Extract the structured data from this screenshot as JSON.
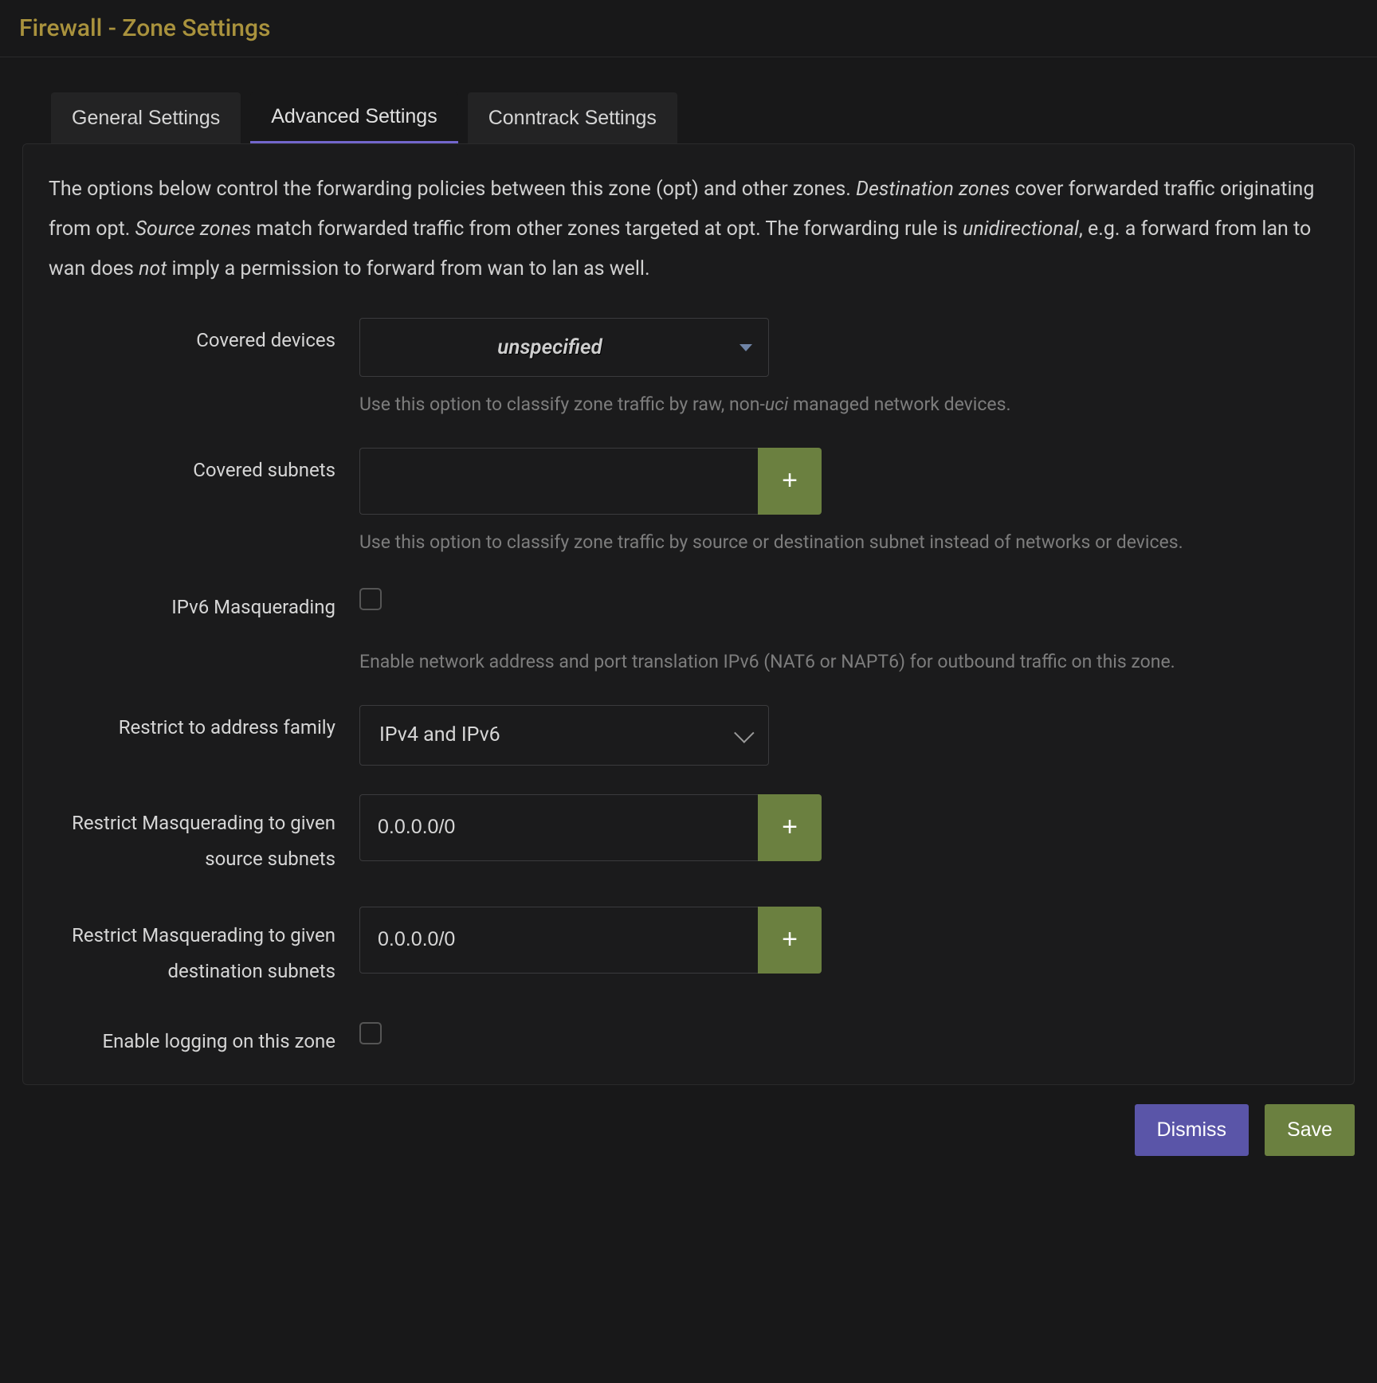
{
  "header": {
    "title": "Firewall - Zone Settings"
  },
  "tabs": {
    "general": "General Settings",
    "advanced": "Advanced Settings",
    "conntrack": "Conntrack Settings"
  },
  "help": {
    "p1a": "The options below control the forwarding policies between this zone (opt) and other zones. ",
    "p1b": "Destination zones",
    "p1c": " cover forwarded traffic originating from opt. ",
    "p1d": "Source zones",
    "p1e": " match forwarded traffic from other zones targeted at opt. The forwarding rule is ",
    "p1f": "unidirectional",
    "p1g": ", e.g. a forward from lan to wan does ",
    "p1h": "not",
    "p1i": " imply a permission to forward from wan to lan as well."
  },
  "fields": {
    "covered_devices": {
      "label": "Covered devices",
      "value": "unspecified",
      "hint_a": "Use this option to classify zone traffic by raw, non-",
      "hint_b": "uci",
      "hint_c": " managed network devices."
    },
    "covered_subnets": {
      "label": "Covered subnets",
      "value": "",
      "hint": "Use this option to classify zone traffic by source or destination subnet instead of networks or devices."
    },
    "ipv6_masq": {
      "label": "IPv6 Masquerading",
      "hint": "Enable network address and port translation IPv6 (NAT6 or NAPT6) for outbound traffic on this zone."
    },
    "family": {
      "label": "Restrict to address family",
      "value": "IPv4 and IPv6"
    },
    "masq_src": {
      "label": "Restrict Masquerading to given source subnets",
      "value": "0.0.0.0/0"
    },
    "masq_dest": {
      "label": "Restrict Masquerading to given destination subnets",
      "value": "0.0.0.0/0"
    },
    "logging": {
      "label": "Enable logging on this zone"
    }
  },
  "footer": {
    "dismiss": "Dismiss",
    "save": "Save"
  },
  "icons": {
    "plus": "+"
  }
}
